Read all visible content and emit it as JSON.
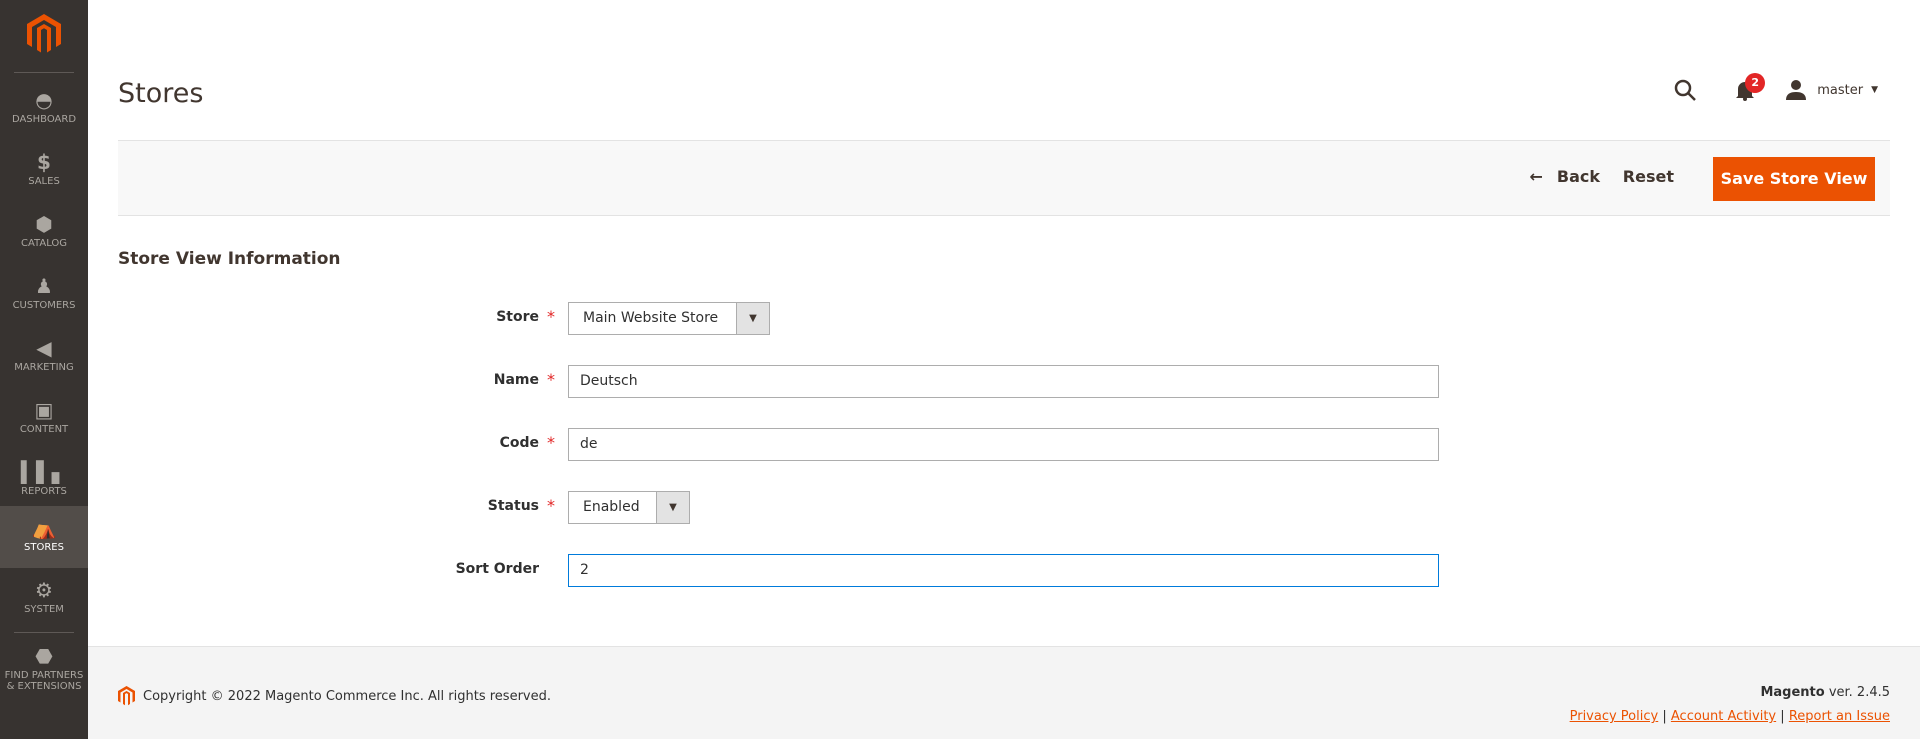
{
  "sidebar": {
    "items": [
      {
        "label": "DASHBOARD",
        "icon": "dashboard-icon"
      },
      {
        "label": "SALES",
        "icon": "dollar-icon"
      },
      {
        "label": "CATALOG",
        "icon": "box-icon"
      },
      {
        "label": "CUSTOMERS",
        "icon": "person-icon"
      },
      {
        "label": "MARKETING",
        "icon": "megaphone-icon"
      },
      {
        "label": "CONTENT",
        "icon": "layout-icon"
      },
      {
        "label": "REPORTS",
        "icon": "bar-chart-icon"
      },
      {
        "label": "STORES",
        "icon": "storefront-icon",
        "active": true
      },
      {
        "label": "SYSTEM",
        "icon": "gear-icon"
      },
      {
        "label": "FIND PARTNERS",
        "label2": "& EXTENSIONS",
        "icon": "blocks-icon"
      }
    ]
  },
  "header": {
    "title": "Stores",
    "notifications": "2",
    "user": "master"
  },
  "actions": {
    "back": "Back",
    "reset": "Reset",
    "save": "Save Store View"
  },
  "form": {
    "section_title": "Store View Information",
    "store": {
      "label": "Store",
      "value": "Main Website Store"
    },
    "name": {
      "label": "Name",
      "value": "Deutsch"
    },
    "code": {
      "label": "Code",
      "value": "de"
    },
    "status": {
      "label": "Status",
      "value": "Enabled"
    },
    "sort_order": {
      "label": "Sort Order",
      "value": "2"
    },
    "required_mark": "*"
  },
  "footer": {
    "copyright": "Copyright © 2022 Magento Commerce Inc. All rights reserved.",
    "brand": "Magento",
    "version": "ver. 2.4.5",
    "links": [
      "Privacy Policy",
      "Account Activity",
      "Report an Issue"
    ],
    "separator": "|"
  },
  "colors": {
    "accent": "#eb5202",
    "sidebar": "#373330",
    "badge": "#e22626"
  }
}
